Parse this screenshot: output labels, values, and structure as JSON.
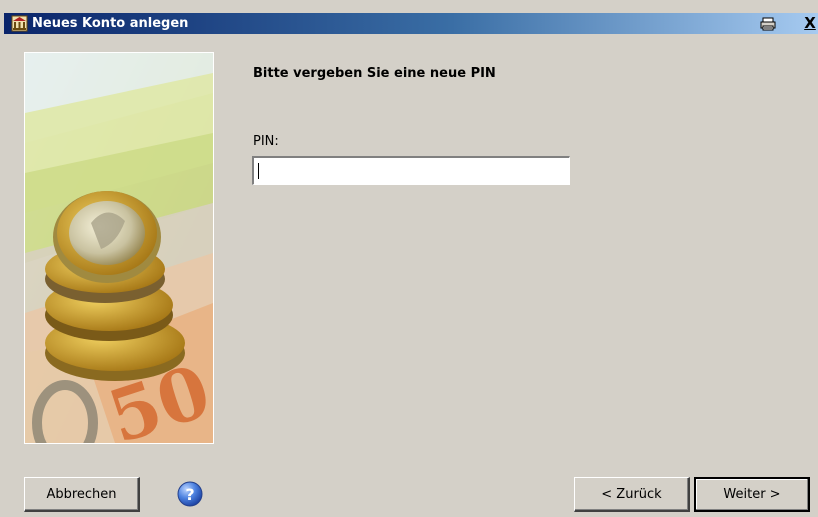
{
  "window": {
    "title": "Neues Konto anlegen",
    "close_label": "X"
  },
  "main": {
    "heading": "Bitte vergeben Sie eine neue PIN",
    "pin_label": "PIN:",
    "pin_value": ""
  },
  "footer": {
    "cancel_label": "Abbrechen",
    "back_label": "< Zurück",
    "next_label": "Weiter >"
  },
  "side_image": {
    "banknote_text": "50"
  },
  "icons": {
    "app": "bank-icon",
    "print": "printer-icon",
    "close": "close-icon",
    "help": "help-icon"
  },
  "colors": {
    "window_bg": "#d4d0c8",
    "title_gradient_start": "#0a246a",
    "title_gradient_end": "#a6caf0",
    "help_blue": "#3a6fd8"
  }
}
